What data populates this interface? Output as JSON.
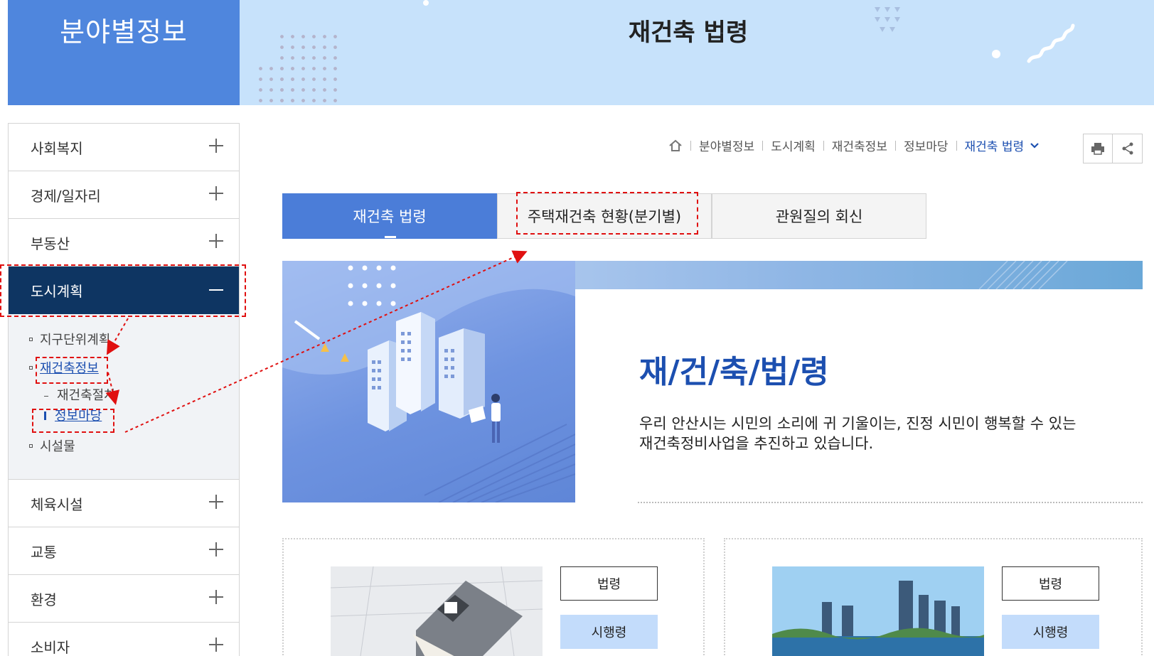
{
  "header": {
    "section_title": "분야별정보",
    "page_title": "재건축 법령"
  },
  "sidebar": {
    "items_top": [
      {
        "label": "사회복지"
      },
      {
        "label": "경제/일자리"
      },
      {
        "label": "부동산"
      }
    ],
    "active": {
      "label": "도시계획"
    },
    "sub": {
      "item1": "지구단위계획",
      "item2": "재건축정보",
      "item2_sub1": "재건축절차",
      "item2_sub2": "정보마당",
      "item3": "시설물"
    },
    "items_bottom": [
      {
        "label": "체육시설"
      },
      {
        "label": "교통"
      },
      {
        "label": "환경"
      },
      {
        "label": "소비자"
      }
    ]
  },
  "breadcrumb": {
    "items": [
      "분야별정보",
      "도시계획",
      "재건축정보",
      "정보마당"
    ],
    "current": "재건축 법령",
    "icons": {
      "home": "home-icon",
      "chevron": "chevron-down-icon",
      "print": "printer-icon",
      "share": "share-icon"
    }
  },
  "tabs": [
    {
      "label": "재건축 법령",
      "active": true
    },
    {
      "label": "주택재건축 현황(분기별)",
      "active": false
    },
    {
      "label": "관원질의 회신",
      "active": false
    }
  ],
  "banner": {
    "title": "재/건/축/법/령",
    "desc_line1": "우리 안산시는 시민의 소리에 귀 기울이는, 진정 시민이 행복할 수 있는",
    "desc_line2": "재건축정비사업을 추진하고 있습니다."
  },
  "cards": [
    {
      "btn1": "법령",
      "btn2": "시행령"
    },
    {
      "btn1": "법령",
      "btn2": "시행령"
    }
  ],
  "colors": {
    "header_left": "#4f86dd",
    "header_right": "#c7e2fb",
    "sidebar_active": "#0e3562",
    "tab_active": "#4b7dd8",
    "link": "#1c4fb0",
    "annotation": "#e01010"
  }
}
